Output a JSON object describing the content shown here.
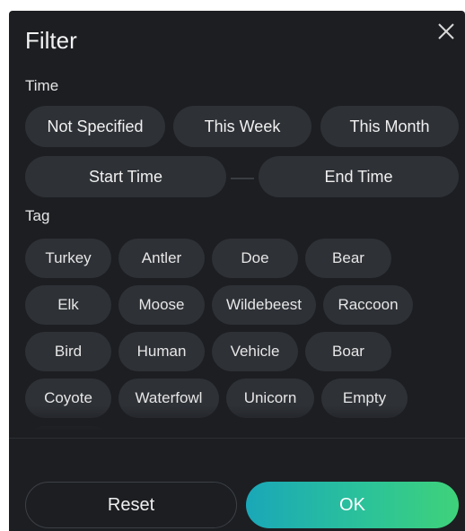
{
  "header": {
    "title": "Filter",
    "close_icon": "close-icon"
  },
  "time": {
    "label": "Time",
    "presets": [
      "Not Specified",
      "This Week",
      "This Month"
    ],
    "start_label": "Start Time",
    "end_label": "End Time"
  },
  "tag": {
    "label": "Tag",
    "rows": [
      [
        "Turkey",
        "Antler",
        "Doe",
        "Bear"
      ],
      [
        "Elk",
        "Moose",
        "Wildebeest",
        "Raccoon"
      ],
      [
        "Bird",
        "Human",
        "Vehicle",
        "Boar"
      ],
      [
        "Coyote",
        "Waterfowl",
        "Unicorn",
        "Empty"
      ]
    ]
  },
  "footer": {
    "reset_label": "Reset",
    "ok_label": "OK"
  },
  "colors": {
    "panel_bg": "#1c1e22",
    "chip_bg": "#2e3136",
    "ok_gradient_start": "#1aa7b8",
    "ok_gradient_end": "#3fd27a"
  }
}
